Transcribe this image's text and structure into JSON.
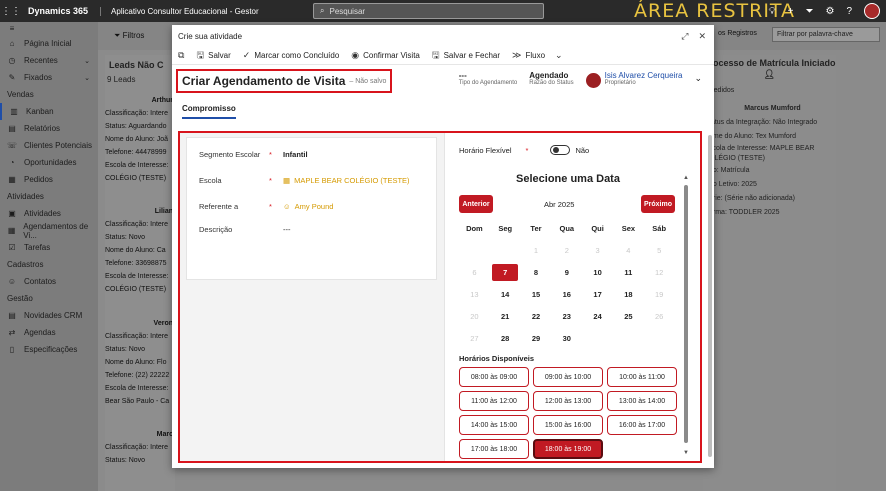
{
  "topbar": {
    "brand": "Dynamics 365",
    "app_name": "Aplicativo Consultor Educacional - Gestor",
    "search_placeholder": "Pesquisar",
    "banner": "ÁREA RESTRITA"
  },
  "nav": {
    "home": "Página Inicial",
    "recent": "Recentes",
    "pinned": "Fixados",
    "sections": [
      {
        "title": "Vendas",
        "items": [
          "Kanban",
          "Relatórios",
          "Clientes Potenciais",
          "Oportunidades",
          "Pedidos"
        ]
      },
      {
        "title": "Atividades",
        "items": [
          "Atividades",
          "Agendamentos de Vi...",
          "Tarefas"
        ]
      },
      {
        "title": "Cadastros",
        "items": [
          "Contatos"
        ]
      },
      {
        "title": "Gestão",
        "items": [
          "Novidades CRM",
          "Agendas",
          "Especificações"
        ]
      }
    ]
  },
  "board": {
    "filters": "Filtros",
    "records_label": "os Registros",
    "filter_placeholder": "Filtrar por palavra-chave",
    "left_column": {
      "title": "Leads Não C",
      "count": "9 Leads",
      "cards": [
        {
          "name": "Arthur",
          "lines": [
            "Classificação: Intere",
            "Status: Aguardando",
            "Nome do Aluno: Joã",
            "Telefone: 44478999",
            "Escola de Interesse:",
            "COLÉGIO (TESTE)"
          ]
        },
        {
          "name": "Lilian",
          "lines": [
            "Classificação: Intere",
            "Status: Novo",
            "Nome do Aluno: Ca",
            "Telefone: 33698875",
            "Escola de Interesse:",
            "COLÉGIO (TESTE)"
          ]
        },
        {
          "name": "Veron",
          "lines": [
            "Classificação: Intere",
            "Status: Novo",
            "Nome do Aluno: Flo",
            "Telefone: (22) 22222",
            "Escola de Interesse:",
            "Bear São Paulo - Ca"
          ]
        },
        {
          "name": "Marc",
          "lines": [
            "Classificação: Intere",
            "Status: Novo"
          ]
        }
      ]
    },
    "right_column": {
      "title": "Processo de Matrícula Iniciado",
      "subtitle": "Pedidos",
      "card_name": "Marcus Mumford",
      "lines": [
        "tatus da Integração: Não Integrado",
        "ome do Aluno: Tex Mumford",
        "scola de Interesse: MAPLE BEAR",
        "OLÉGIO (TESTE)",
        "po: Matrícula",
        "no Letivo: 2025",
        "érie: (Série não adicionada)",
        "urma: TODDLER 2025"
      ]
    }
  },
  "modal": {
    "window_title": "Crie sua atividade",
    "toolbar": {
      "save": "Salvar",
      "mark_complete": "Marcar como Concluído",
      "confirm_visit": "Confirmar Visita",
      "save_close": "Salvar e Fechar",
      "flow": "Fluxo"
    },
    "record_title": "Criar Agendamento de Visita",
    "record_status": "– Não salvo",
    "header_fields": {
      "type_value": "---",
      "type_label": "Tipo do Agendamento",
      "reason_value": "Agendado",
      "reason_label": "Razão do Status",
      "owner_value": "Isis Alvarez Cerqueira",
      "owner_label": "Proprietário"
    },
    "tab": "Compromisso",
    "fields": {
      "segment_label": "Segmento Escolar",
      "segment_value": "Infantil",
      "school_label": "Escola",
      "school_value": "MAPLE BEAR COLÉGIO (TESTE)",
      "referent_label": "Referente a",
      "referent_value": "Amy Pound",
      "description_label": "Descrição",
      "description_value": "---"
    },
    "flex_label": "Horário Flexível",
    "flex_value": "Não",
    "calendar": {
      "title": "Selecione uma Data",
      "prev": "Anterior",
      "next": "Próximo",
      "month": "Abr 2025",
      "weekdays": [
        "Dom",
        "Seg",
        "Ter",
        "Qua",
        "Qui",
        "Sex",
        "Sáb"
      ],
      "weeks": [
        [
          {
            "d": "",
            "s": ""
          },
          {
            "d": "",
            "s": ""
          },
          {
            "d": "1",
            "s": "dim"
          },
          {
            "d": "2",
            "s": "dim"
          },
          {
            "d": "3",
            "s": "dim"
          },
          {
            "d": "4",
            "s": "dim"
          },
          {
            "d": "5",
            "s": "dim"
          }
        ],
        [
          {
            "d": "6",
            "s": "dim"
          },
          {
            "d": "7",
            "s": "sel"
          },
          {
            "d": "8",
            "s": ""
          },
          {
            "d": "9",
            "s": ""
          },
          {
            "d": "10",
            "s": ""
          },
          {
            "d": "11",
            "s": ""
          },
          {
            "d": "12",
            "s": "dim"
          }
        ],
        [
          {
            "d": "13",
            "s": "dim"
          },
          {
            "d": "14",
            "s": ""
          },
          {
            "d": "15",
            "s": ""
          },
          {
            "d": "16",
            "s": ""
          },
          {
            "d": "17",
            "s": ""
          },
          {
            "d": "18",
            "s": ""
          },
          {
            "d": "19",
            "s": "dim"
          }
        ],
        [
          {
            "d": "20",
            "s": "dim"
          },
          {
            "d": "21",
            "s": ""
          },
          {
            "d": "22",
            "s": ""
          },
          {
            "d": "23",
            "s": ""
          },
          {
            "d": "24",
            "s": ""
          },
          {
            "d": "25",
            "s": ""
          },
          {
            "d": "26",
            "s": "dim"
          }
        ],
        [
          {
            "d": "27",
            "s": "dim"
          },
          {
            "d": "28",
            "s": ""
          },
          {
            "d": "29",
            "s": ""
          },
          {
            "d": "30",
            "s": ""
          },
          {
            "d": "",
            "s": ""
          },
          {
            "d": "",
            "s": ""
          },
          {
            "d": "",
            "s": ""
          }
        ]
      ]
    },
    "slots_title": "Horários Disponíveis",
    "slots": [
      {
        "label": "08:00 às 09:00",
        "selected": false
      },
      {
        "label": "09:00 às 10:00",
        "selected": false
      },
      {
        "label": "10:00 às 11:00",
        "selected": false
      },
      {
        "label": "11:00 às 12:00",
        "selected": false
      },
      {
        "label": "12:00 às 13:00",
        "selected": false
      },
      {
        "label": "13:00 às 14:00",
        "selected": false
      },
      {
        "label": "14:00 às 15:00",
        "selected": false
      },
      {
        "label": "15:00 às 16:00",
        "selected": false
      },
      {
        "label": "16:00 às 17:00",
        "selected": false
      },
      {
        "label": "17:00 às 18:00",
        "selected": false
      },
      {
        "label": "18:00 às 19:00",
        "selected": true
      }
    ]
  },
  "colors": {
    "accent_red": "#c11a23",
    "highlight_border": "#d8141c",
    "link_blue": "#1f4ea8",
    "lookup_gold": "#d59a00",
    "banner_gold": "#e8c340"
  }
}
